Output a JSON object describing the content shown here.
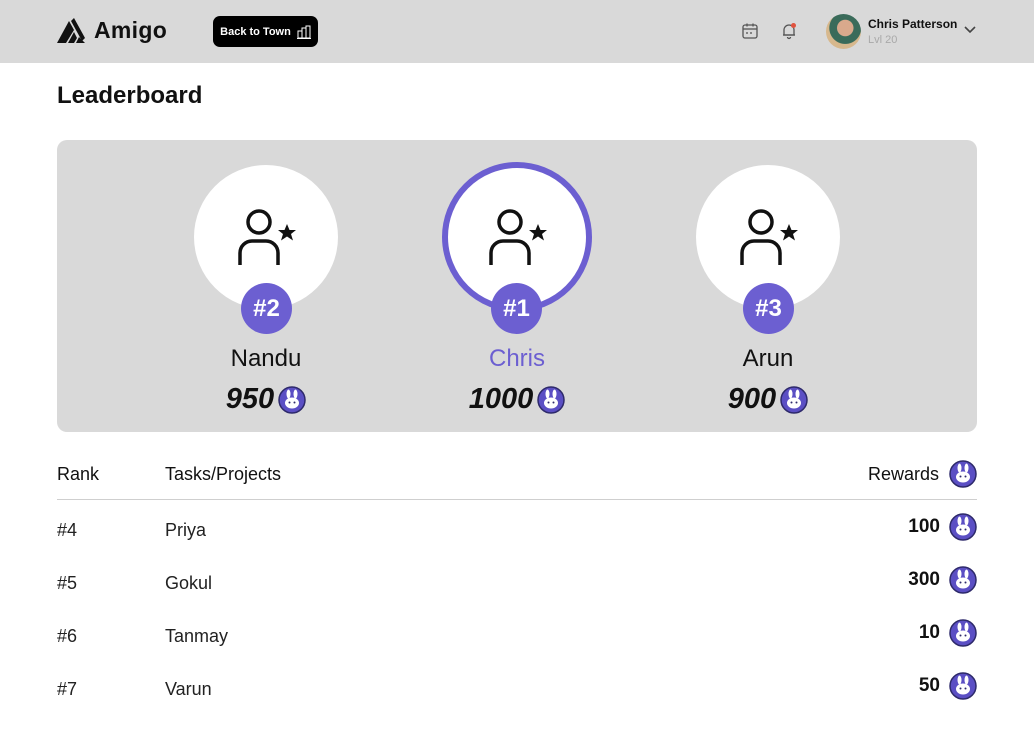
{
  "app": {
    "name": "Amigo",
    "back_button": "Back to Town"
  },
  "header": {
    "icons": [
      "calendar-icon",
      "bell-icon",
      "chevron-down-icon"
    ]
  },
  "user": {
    "name": "Chris Patterson",
    "level": "Lvl 20"
  },
  "page": {
    "title": "Leaderboard"
  },
  "podium": [
    {
      "rank": "#2",
      "name": "Nandu",
      "score": "950"
    },
    {
      "rank": "#1",
      "name": "Chris",
      "score": "1000"
    },
    {
      "rank": "#3",
      "name": "Arun",
      "score": "900"
    }
  ],
  "table": {
    "columns": {
      "rank": "Rank",
      "name": "Tasks/Projects",
      "rewards": "Rewards"
    },
    "rows": [
      {
        "rank": "#4",
        "name": "Priya",
        "reward": "100"
      },
      {
        "rank": "#5",
        "name": "Gokul",
        "reward": "300"
      },
      {
        "rank": "#6",
        "name": "Tanmay",
        "reward": "10"
      },
      {
        "rank": "#7",
        "name": "Varun",
        "reward": "50"
      }
    ]
  },
  "colors": {
    "accent": "#6c5fd1",
    "header_bg": "#d9d9d9",
    "panel_bg": "#d9d9d9",
    "coin": "#5b4fc4"
  }
}
